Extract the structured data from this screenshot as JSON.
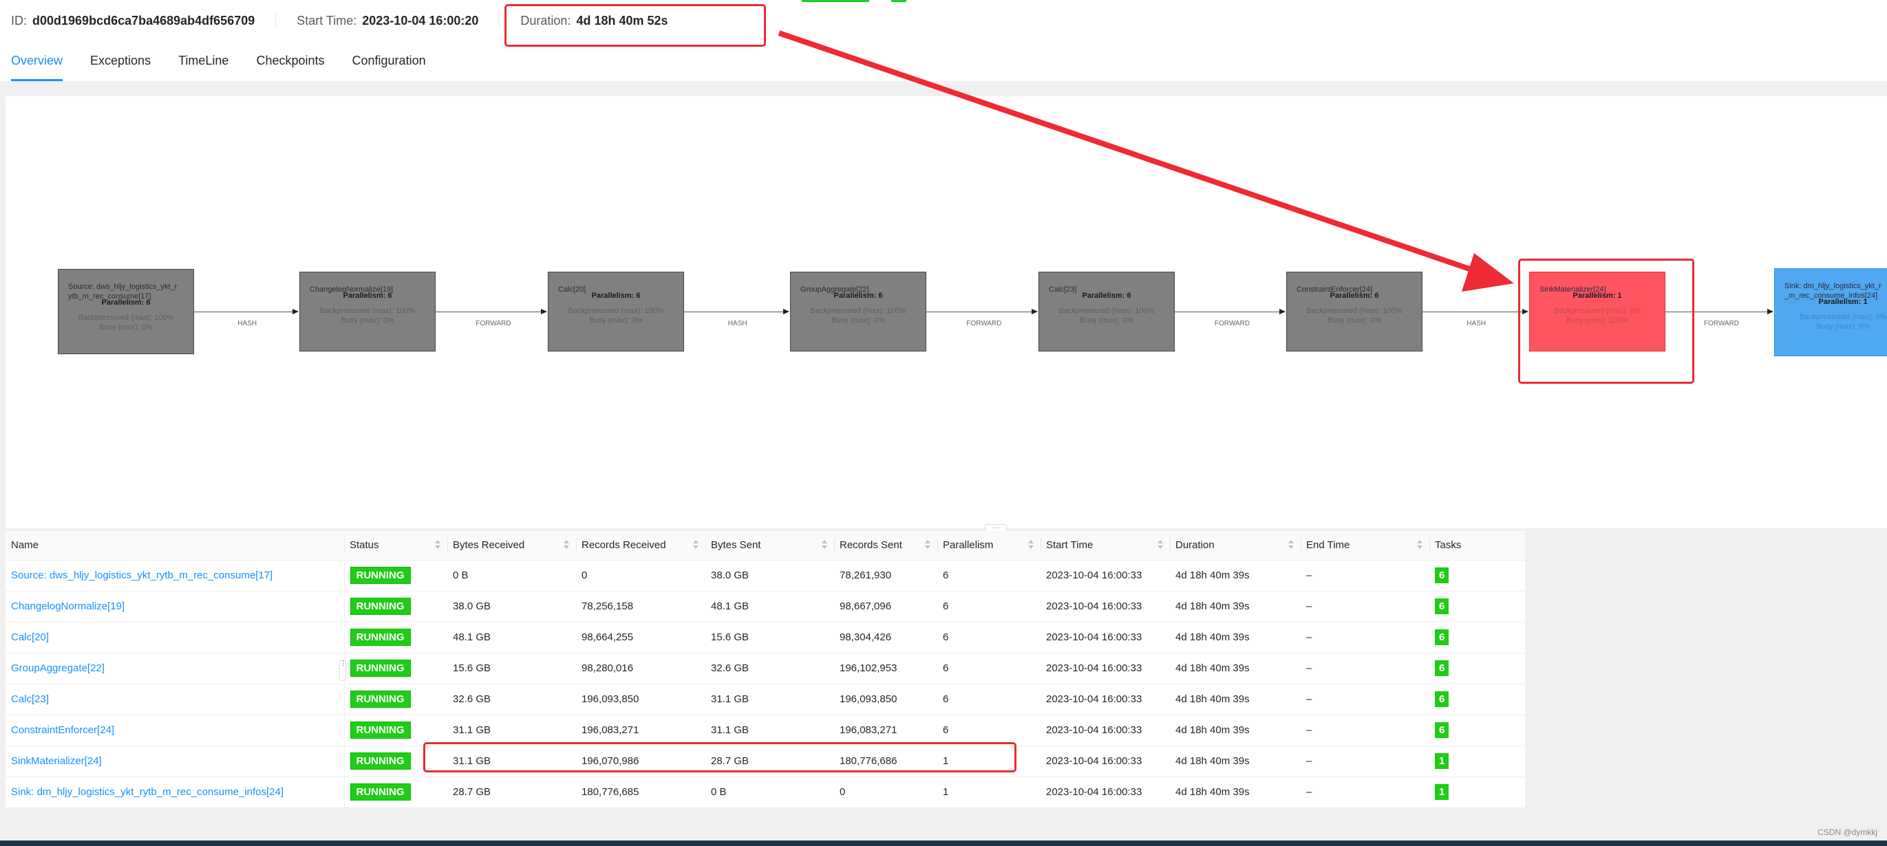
{
  "job": {
    "id_label": "ID:",
    "id_value": "d00d1969bcd6ca7ba4689ab4df656709",
    "start_time_label": "Start Time:",
    "start_time_value": "2023-10-04 16:00:20",
    "duration_label": "Duration:",
    "duration_value": "4d 18h 40m 52s"
  },
  "tabs": [
    {
      "label": "Overview",
      "active": true
    },
    {
      "label": "Exceptions",
      "active": false
    },
    {
      "label": "TimeLine",
      "active": false
    },
    {
      "label": "Checkpoints",
      "active": false
    },
    {
      "label": "Configuration",
      "active": false
    }
  ],
  "graph": {
    "nodes": [
      {
        "name": "Source: dws_hljy_logistics_ykt_rytb_m_rec_consume[17]",
        "name_line1": "Source: dws_hljy_logistics_ykt_r",
        "name_line2": "ytb_m_rec_consume[17]",
        "parallelism": "Parallelism: 6",
        "backpressured": "Backpressured (max): 100%",
        "busy": "Busy (max): 0%",
        "state": "backpressured"
      },
      {
        "name": "ChangelogNormalize[19]",
        "name_line1": "ChangelogNormalize[19]",
        "name_line2": "",
        "parallelism": "Parallelism: 6",
        "backpressured": "Backpressured (max): 100%",
        "busy": "Busy (max): 0%",
        "state": "backpressured"
      },
      {
        "name": "Calc[20]",
        "name_line1": "Calc[20]",
        "name_line2": "",
        "parallelism": "Parallelism: 6",
        "backpressured": "Backpressured (max): 100%",
        "busy": "Busy (max): 0%",
        "state": "backpressured"
      },
      {
        "name": "GroupAggregate[22]",
        "name_line1": "GroupAggregate[22]",
        "name_line2": "",
        "parallelism": "Parallelism: 6",
        "backpressured": "Backpressured (max): 100%",
        "busy": "Busy (max): 0%",
        "state": "backpressured"
      },
      {
        "name": "Calc[23]",
        "name_line1": "Calc[23]",
        "name_line2": "",
        "parallelism": "Parallelism: 6",
        "backpressured": "Backpressured (max): 100%",
        "busy": "Busy (max): 0%",
        "state": "backpressured"
      },
      {
        "name": "ConstraintEnforcer[24]",
        "name_line1": "ConstraintEnforcer[24]",
        "name_line2": "",
        "parallelism": "Parallelism: 6",
        "backpressured": "Backpressured (max): 100%",
        "busy": "Busy (max): 0%",
        "state": "backpressured"
      },
      {
        "name": "SinkMaterializer[24]",
        "name_line1": "SinkMaterializer[24]",
        "name_line2": "",
        "parallelism": "Parallelism: 1",
        "backpressured": "Backpressured (max): 0%",
        "busy": "Busy (max): 100%",
        "state": "busy"
      },
      {
        "name": "Sink: dm_hljy_logistics_ykt_rytb_m_rec_consume_infos[24]",
        "name_line1": "Sink: dm_hljy_logistics_ykt_r",
        "name_line2": "_m_rec_consume_infos[24]",
        "parallelism": "Parallelism: 1",
        "backpressured": "Backpressured (max): 0%",
        "busy": "Busy (max): 9%",
        "state": "idle"
      }
    ],
    "edges": [
      "HASH",
      "FORWARD",
      "HASH",
      "FORWARD",
      "FORWARD",
      "HASH",
      "FORWARD"
    ]
  },
  "resizer_label": "...",
  "table": {
    "columns": [
      "Name",
      "Status",
      "Bytes Received",
      "Records Received",
      "Bytes Sent",
      "Records Sent",
      "Parallelism",
      "Start Time",
      "Duration",
      "End Time",
      "Tasks"
    ],
    "rows": [
      {
        "name": "Source: dws_hljy_logistics_ykt_rytb_m_rec_consume[17]",
        "status": "RUNNING",
        "bytes_received": "0 B",
        "records_received": "0",
        "bytes_sent": "38.0 GB",
        "records_sent": "78,261,930",
        "parallelism": "6",
        "start_time": "2023-10-04 16:00:33",
        "duration": "4d 18h 40m 39s",
        "end_time": "–",
        "tasks": "6"
      },
      {
        "name": "ChangelogNormalize[19]",
        "status": "RUNNING",
        "bytes_received": "38.0 GB",
        "records_received": "78,256,158",
        "bytes_sent": "48.1 GB",
        "records_sent": "98,667,096",
        "parallelism": "6",
        "start_time": "2023-10-04 16:00:33",
        "duration": "4d 18h 40m 39s",
        "end_time": "–",
        "tasks": "6"
      },
      {
        "name": "Calc[20]",
        "status": "RUNNING",
        "bytes_received": "48.1 GB",
        "records_received": "98,664,255",
        "bytes_sent": "15.6 GB",
        "records_sent": "98,304,426",
        "parallelism": "6",
        "start_time": "2023-10-04 16:00:33",
        "duration": "4d 18h 40m 39s",
        "end_time": "–",
        "tasks": "6"
      },
      {
        "name": "GroupAggregate[22]",
        "status": "RUNNING",
        "bytes_received": "15.6 GB",
        "records_received": "98,280,016",
        "bytes_sent": "32.6 GB",
        "records_sent": "196,102,953",
        "parallelism": "6",
        "start_time": "2023-10-04 16:00:33",
        "duration": "4d 18h 40m 39s",
        "end_time": "–",
        "tasks": "6"
      },
      {
        "name": "Calc[23]",
        "status": "RUNNING",
        "bytes_received": "32.6 GB",
        "records_received": "196,093,850",
        "bytes_sent": "31.1 GB",
        "records_sent": "196,093,850",
        "parallelism": "6",
        "start_time": "2023-10-04 16:00:33",
        "duration": "4d 18h 40m 39s",
        "end_time": "–",
        "tasks": "6"
      },
      {
        "name": "ConstraintEnforcer[24]",
        "status": "RUNNING",
        "bytes_received": "31.1 GB",
        "records_received": "196,083,271",
        "bytes_sent": "31.1 GB",
        "records_sent": "196,083,271",
        "parallelism": "6",
        "start_time": "2023-10-04 16:00:33",
        "duration": "4d 18h 40m 39s",
        "end_time": "–",
        "tasks": "6"
      },
      {
        "name": "SinkMaterializer[24]",
        "status": "RUNNING",
        "bytes_received": "31.1 GB",
        "records_received": "196,070,986",
        "bytes_sent": "28.7 GB",
        "records_sent": "180,776,686",
        "parallelism": "1",
        "start_time": "2023-10-04 16:00:33",
        "duration": "4d 18h 40m 39s",
        "end_time": "–",
        "tasks": "1"
      },
      {
        "name": "Sink: dm_hljy_logistics_ykt_rytb_m_rec_consume_infos[24]",
        "status": "RUNNING",
        "bytes_received": "28.7 GB",
        "records_received": "180,776,685",
        "bytes_sent": "0 B",
        "records_sent": "0",
        "parallelism": "1",
        "start_time": "2023-10-04 16:00:33",
        "duration": "4d 18h 40m 39s",
        "end_time": "–",
        "tasks": "1"
      }
    ]
  },
  "colors": {
    "accent": "#1890ff",
    "running": "#1fcc16",
    "backpressured_node": "#808080",
    "busy_node": "#ff5560",
    "idle_node": "#50a8f0",
    "annotation": "#ee2a35"
  },
  "watermark": "CSDN @dymkkj"
}
